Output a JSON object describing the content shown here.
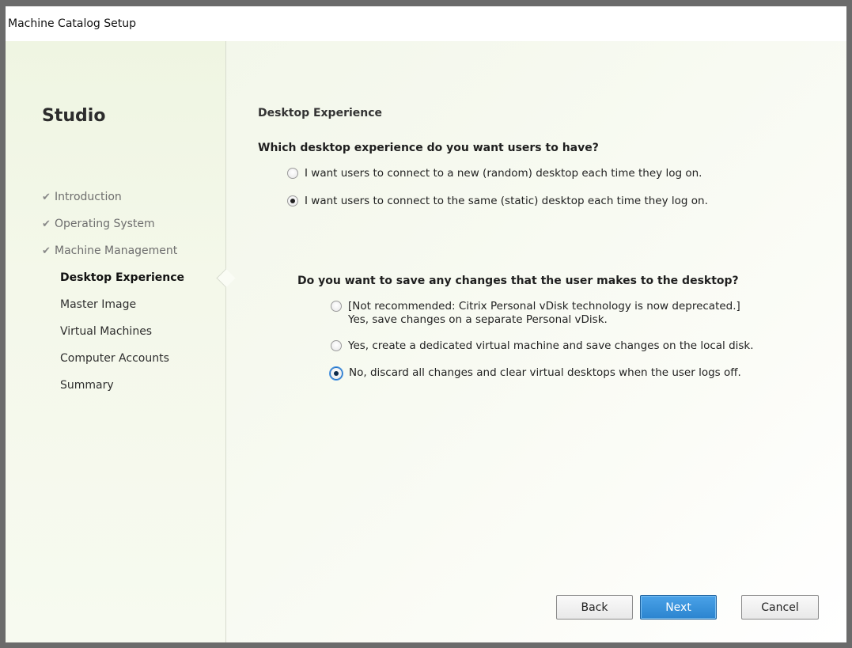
{
  "window": {
    "title": "Machine Catalog Setup"
  },
  "sidebar": {
    "app_name": "Studio",
    "steps": [
      {
        "label": "Introduction",
        "status": "done"
      },
      {
        "label": "Operating System",
        "status": "done"
      },
      {
        "label": "Machine Management",
        "status": "done"
      },
      {
        "label": "Desktop Experience",
        "status": "active"
      },
      {
        "label": "Master Image",
        "status": "pending"
      },
      {
        "label": "Virtual Machines",
        "status": "pending"
      },
      {
        "label": "Computer Accounts",
        "status": "pending"
      },
      {
        "label": "Summary",
        "status": "pending"
      }
    ],
    "check_glyph": "✔"
  },
  "main": {
    "heading": "Desktop Experience",
    "question1": "Which desktop experience do you want users to have?",
    "q1_options": [
      {
        "label": "I want users to connect to a new (random) desktop each time they log on.",
        "checked": false
      },
      {
        "label": "I want users to connect to the same (static) desktop each time they log on.",
        "checked": true
      }
    ],
    "question2": "Do you want to save any changes that the user makes to the desktop?",
    "q2_options": [
      {
        "line1": "[Not recommended: Citrix Personal vDisk technology is now deprecated.]",
        "line2": "Yes, save changes on a separate Personal vDisk.",
        "checked": false
      },
      {
        "label": "Yes, create a dedicated virtual machine and save changes on the local disk.",
        "checked": false
      },
      {
        "label": "No, discard all changes and clear virtual desktops when the user logs off.",
        "checked": true
      }
    ]
  },
  "buttons": {
    "back": "Back",
    "next": "Next",
    "cancel": "Cancel"
  },
  "colors": {
    "accent": "#2b84cf",
    "sidebar_bg": "#eff5e2",
    "border": "#6b6b6b"
  }
}
